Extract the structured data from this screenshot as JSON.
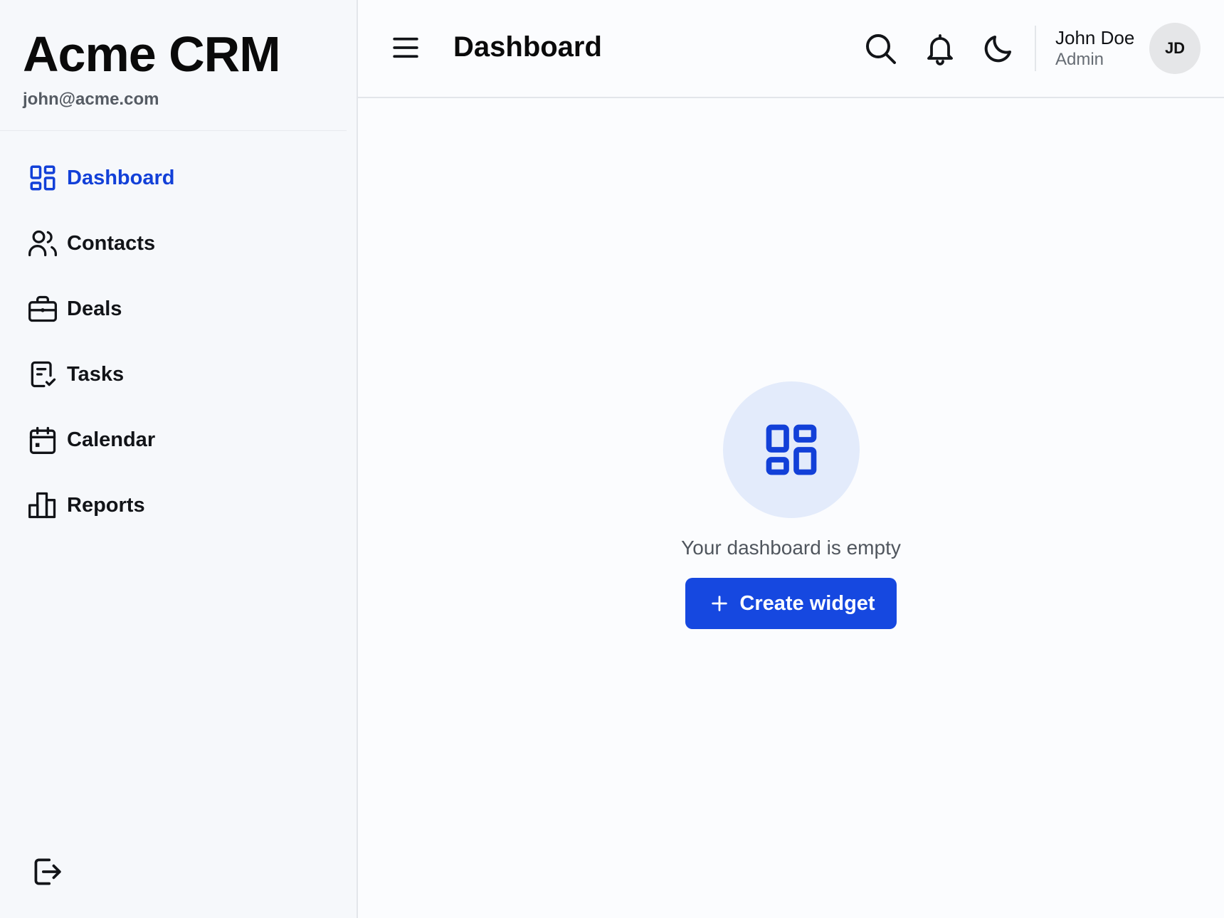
{
  "brand": {
    "title": "Acme CRM",
    "email": "john@acme.com"
  },
  "sidebar": {
    "items": [
      {
        "label": "Dashboard",
        "icon": "dashboard-icon",
        "active": true
      },
      {
        "label": "Contacts",
        "icon": "users-icon",
        "active": false
      },
      {
        "label": "Deals",
        "icon": "briefcase-icon",
        "active": false
      },
      {
        "label": "Tasks",
        "icon": "task-checklist-icon",
        "active": false
      },
      {
        "label": "Calendar",
        "icon": "calendar-icon",
        "active": false
      },
      {
        "label": "Reports",
        "icon": "bar-chart-icon",
        "active": false
      }
    ],
    "logout_icon": "logout-icon"
  },
  "header": {
    "title": "Dashboard",
    "icons": [
      "menu-icon",
      "search-icon",
      "bell-icon",
      "moon-icon"
    ],
    "user": {
      "name": "John Doe",
      "role": "Admin",
      "initials": "JD"
    }
  },
  "main": {
    "empty_state": {
      "icon": "dashboard-icon",
      "message": "Your dashboard is empty",
      "button_label": "Create widget"
    }
  },
  "colors": {
    "accent": "#1648e0",
    "active_text": "#1240d8",
    "sidebar_bg": "#f6f8fb",
    "empty_circle": "#e3ebfb"
  }
}
